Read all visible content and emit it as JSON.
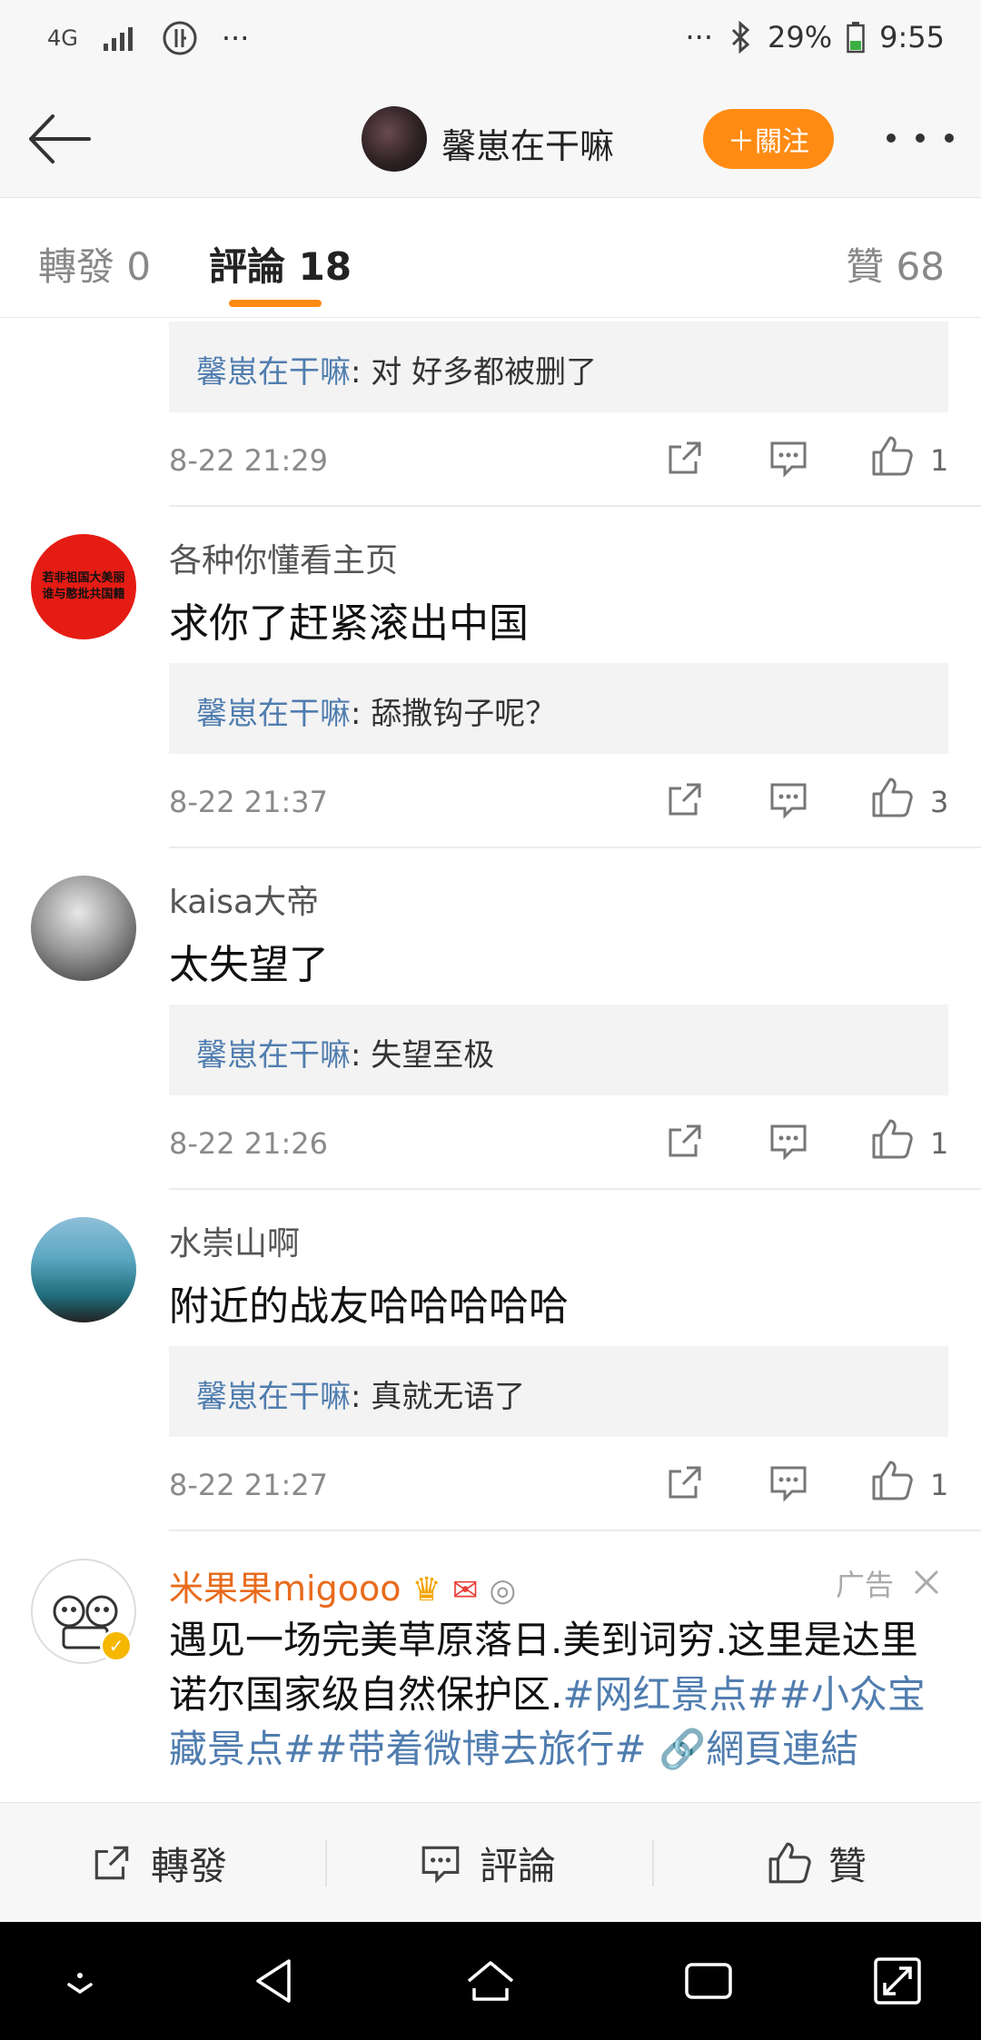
{
  "status_bar": {
    "network": "4G",
    "battery": "29%",
    "time": "9:55",
    "overflow": "···"
  },
  "header": {
    "title": "馨崽在干嘛",
    "follow_label": "＋關注"
  },
  "tabs": {
    "repost": "轉發 0",
    "comment": "評論 18",
    "likes": "贊 68"
  },
  "comments": [
    {
      "reply_author": "馨崽在干嘛",
      "reply_text": ": 对 好多都被删了",
      "time": "8-22 21:29",
      "likes": "1"
    },
    {
      "username": "各种你懂看主页",
      "avatar_text": [
        "若非祖国大美丽",
        "谁与憨批共国籍"
      ],
      "text": "求你了赶紧滚出中国",
      "reply_author": "馨崽在干嘛",
      "reply_text": ": 舔撒钩子呢？",
      "time": "8-22 21:37",
      "likes": "3"
    },
    {
      "username": "kaisa大帝",
      "text": "太失望了",
      "reply_author": "馨崽在干嘛",
      "reply_text": ": 失望至极",
      "time": "8-22 21:26",
      "likes": "1"
    },
    {
      "username": "水崇山啊",
      "text": "附近的战友哈哈哈哈哈",
      "reply_author": "馨崽在干嘛",
      "reply_text": ": 真就无语了",
      "time": "8-22 21:27",
      "likes": "1"
    }
  ],
  "ad": {
    "username": "米果果migooo",
    "label": "广告",
    "text_plain": "遇见一场完美草原落日.美到词穷.这里是达里诺尔国家级自然保护区.",
    "hashtags": "#网红景点##小众宝藏景点##带着微博去旅行#",
    "link": "網頁連結"
  },
  "bottom_bar": {
    "repost": "轉發",
    "comment": "評論",
    "like": "贊"
  },
  "colors": {
    "accent": "#ff8b13",
    "link": "#507daf",
    "ad_name": "#e86b1c"
  }
}
